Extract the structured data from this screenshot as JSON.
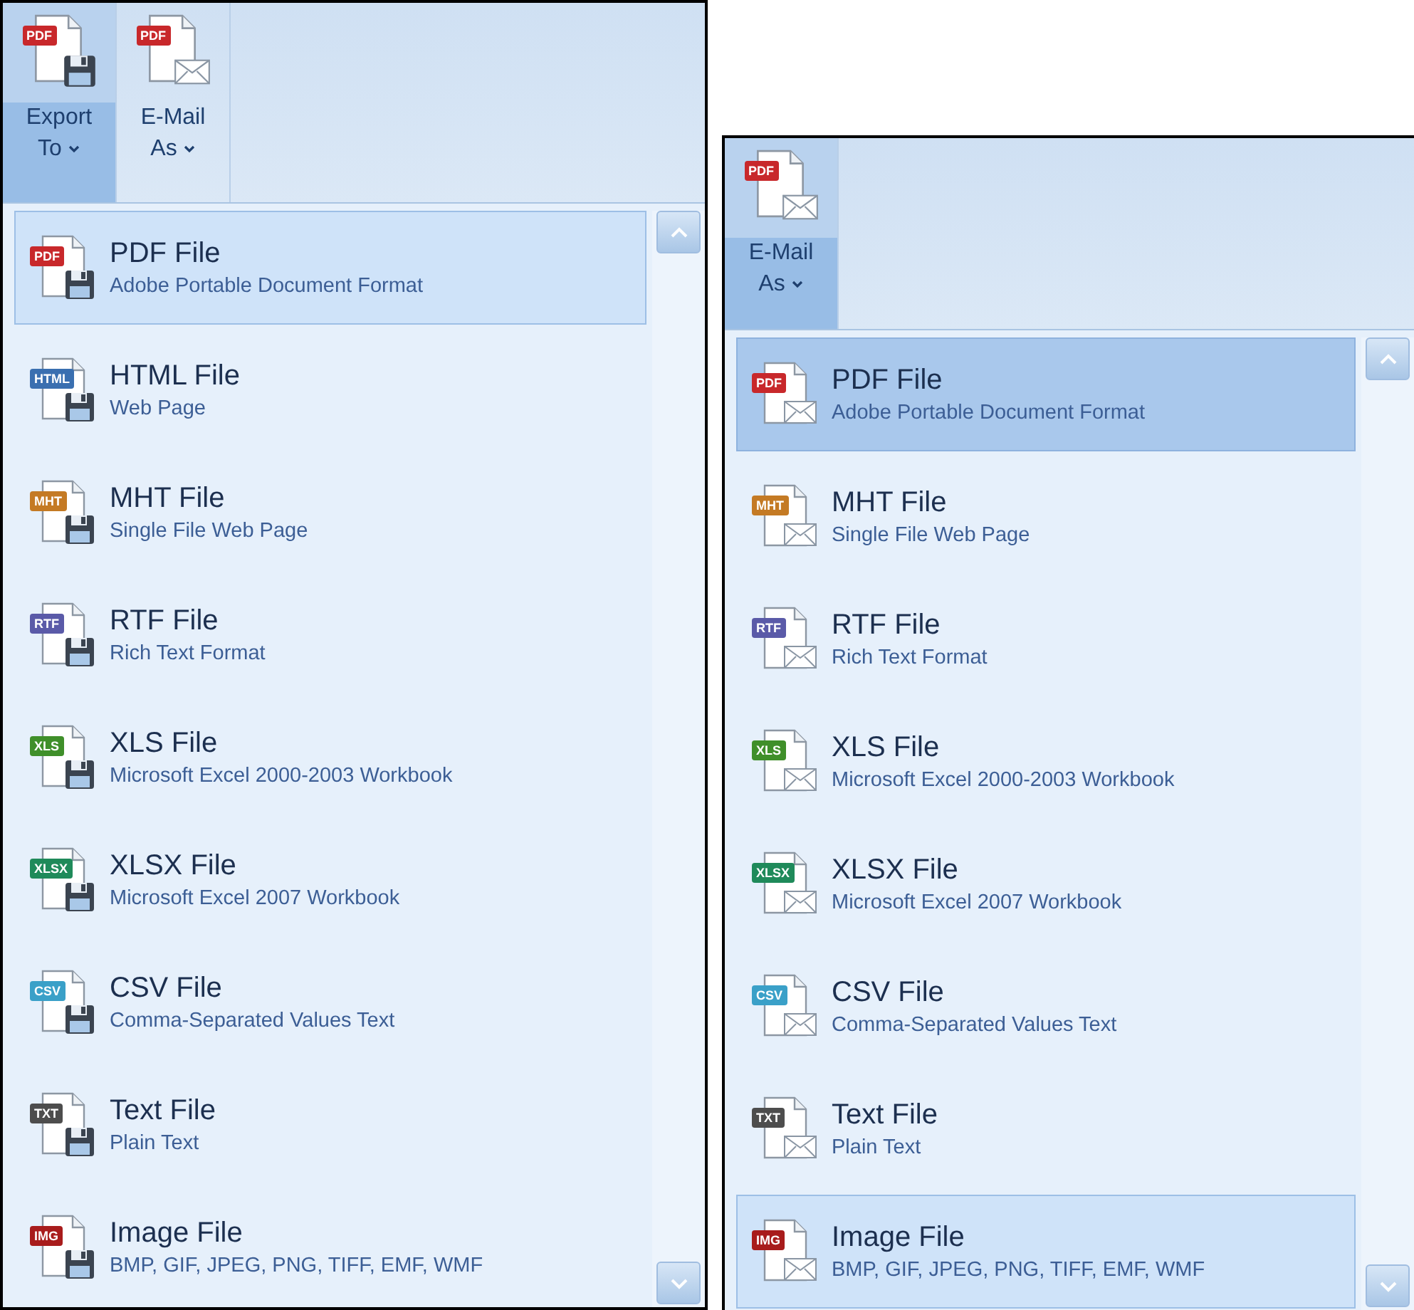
{
  "panels": [
    {
      "kind": "export",
      "toolbar": [
        {
          "kind": "export",
          "badge": "PDF",
          "color": "#c8282b",
          "label": "Export To",
          "selected": true
        },
        {
          "kind": "email",
          "badge": "PDF",
          "color": "#c8282b",
          "label": "E-Mail As",
          "selected": false
        }
      ],
      "items": [
        {
          "badge": "PDF",
          "color": "#c8282b",
          "title": "PDF File",
          "description": "Adobe Portable Document Format",
          "hovered": true,
          "pressed": false
        },
        {
          "badge": "HTML",
          "color": "#3a6fb0",
          "title": "HTML File",
          "description": "Web Page",
          "hovered": false,
          "pressed": false
        },
        {
          "badge": "MHT",
          "color": "#c47a24",
          "title": "MHT File",
          "description": "Single File Web Page",
          "hovered": false,
          "pressed": false
        },
        {
          "badge": "RTF",
          "color": "#5a5aa8",
          "title": "RTF File",
          "description": "Rich Text Format",
          "hovered": false,
          "pressed": false
        },
        {
          "badge": "XLS",
          "color": "#3f8f2a",
          "title": "XLS File",
          "description": "Microsoft Excel 2000-2003 Workbook",
          "hovered": false,
          "pressed": false
        },
        {
          "badge": "XLSX",
          "color": "#1f8a5a",
          "title": "XLSX File",
          "description": "Microsoft Excel 2007 Workbook",
          "hovered": false,
          "pressed": false
        },
        {
          "badge": "CSV",
          "color": "#3aa0c8",
          "title": "CSV File",
          "description": "Comma-Separated Values Text",
          "hovered": false,
          "pressed": false
        },
        {
          "badge": "TXT",
          "color": "#4d4d4d",
          "title": "Text File",
          "description": "Plain Text",
          "hovered": false,
          "pressed": false
        },
        {
          "badge": "IMG",
          "color": "#a81c1c",
          "title": "Image File",
          "description": "BMP, GIF, JPEG, PNG, TIFF, EMF, WMF",
          "hovered": false,
          "pressed": false
        }
      ]
    },
    {
      "kind": "email",
      "toolbar": [
        {
          "kind": "email",
          "badge": "PDF",
          "color": "#c8282b",
          "label": "E-Mail As",
          "selected": true
        }
      ],
      "items": [
        {
          "badge": "PDF",
          "color": "#c8282b",
          "title": "PDF File",
          "description": "Adobe Portable Document Format",
          "hovered": false,
          "pressed": true
        },
        {
          "badge": "MHT",
          "color": "#c47a24",
          "title": "MHT File",
          "description": "Single File Web Page",
          "hovered": false,
          "pressed": false
        },
        {
          "badge": "RTF",
          "color": "#5a5aa8",
          "title": "RTF File",
          "description": "Rich Text Format",
          "hovered": false,
          "pressed": false
        },
        {
          "badge": "XLS",
          "color": "#3f8f2a",
          "title": "XLS File",
          "description": "Microsoft Excel 2000-2003 Workbook",
          "hovered": false,
          "pressed": false
        },
        {
          "badge": "XLSX",
          "color": "#1f8a5a",
          "title": "XLSX File",
          "description": "Microsoft Excel 2007 Workbook",
          "hovered": false,
          "pressed": false
        },
        {
          "badge": "CSV",
          "color": "#3aa0c8",
          "title": "CSV File",
          "description": "Comma-Separated Values Text",
          "hovered": false,
          "pressed": false
        },
        {
          "badge": "TXT",
          "color": "#4d4d4d",
          "title": "Text File",
          "description": "Plain Text",
          "hovered": false,
          "pressed": false
        },
        {
          "badge": "IMG",
          "color": "#a81c1c",
          "title": "Image File",
          "description": "BMP, GIF, JPEG, PNG, TIFF, EMF, WMF",
          "hovered": true,
          "pressed": false
        }
      ]
    }
  ]
}
